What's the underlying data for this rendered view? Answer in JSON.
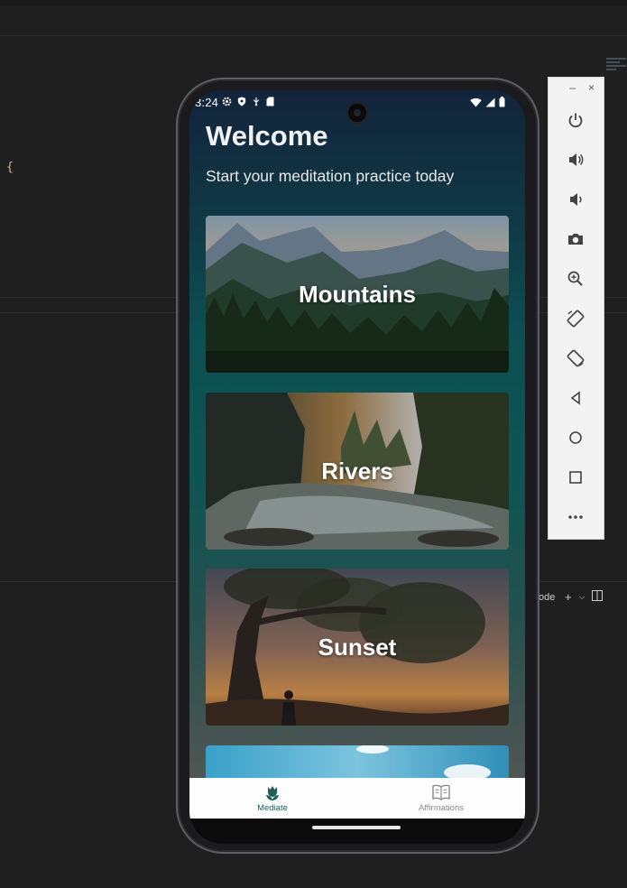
{
  "ide": {
    "brace": "{",
    "panel_label": "ode"
  },
  "emulator": {
    "minimize": "–",
    "close": "×",
    "buttons": [
      "power-icon",
      "volume-up-icon",
      "volume-down-icon",
      "camera-icon",
      "zoom-icon",
      "rotate-left-icon",
      "rotate-right-icon",
      "back-icon",
      "home-icon",
      "overview-icon",
      "more-icon"
    ]
  },
  "status_bar": {
    "time": "3:24"
  },
  "app": {
    "title": "Welcome",
    "subtitle": "Start your meditation practice today",
    "cards": [
      {
        "label": "Mountains"
      },
      {
        "label": "Rivers"
      },
      {
        "label": "Sunset"
      }
    ],
    "nav": [
      {
        "label": "Mediate",
        "icon": "tulip-icon",
        "active": true
      },
      {
        "label": "Affirmations",
        "icon": "book-icon",
        "active": false
      }
    ]
  },
  "colors": {
    "active_nav": "#1f5f58",
    "inactive_nav": "#8a8a8a",
    "emulator_icon": "#444444"
  }
}
